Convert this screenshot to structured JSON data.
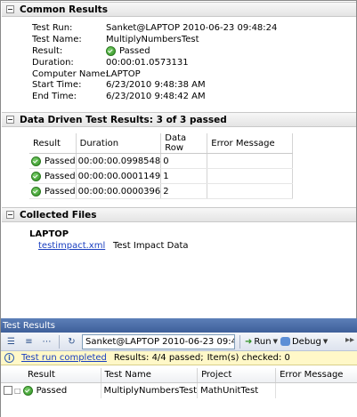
{
  "common_results": {
    "title": "Common Results",
    "fields": [
      {
        "label": "Test Run:",
        "value": "Sanket@LAPTOP 2010-06-23 09:48:24"
      },
      {
        "label": "Test Name:",
        "value": "MultiplyNumbersTest"
      },
      {
        "label": "Result:",
        "value": "Passed",
        "icon": "passed-icon"
      },
      {
        "label": "Duration:",
        "value": "00:00:01.0573131"
      },
      {
        "label": "Computer Name:",
        "value": "LAPTOP"
      },
      {
        "label": "Start Time:",
        "value": "6/23/2010 9:48:38 AM"
      },
      {
        "label": "End Time:",
        "value": "6/23/2010 9:48:42 AM"
      }
    ]
  },
  "data_driven": {
    "title": "Data Driven Test Results: 3 of 3 passed",
    "columns": [
      "Result",
      "Duration",
      "Data Row",
      "Error Message"
    ],
    "rows": [
      {
        "result": "Passed",
        "duration": "00:00:00.0998548",
        "data_row": "0",
        "error": ""
      },
      {
        "result": "Passed",
        "duration": "00:00:00.0001149",
        "data_row": "1",
        "error": ""
      },
      {
        "result": "Passed",
        "duration": "00:00:00.0000396",
        "data_row": "2",
        "error": ""
      }
    ]
  },
  "collected_files": {
    "title": "Collected Files",
    "machine": "LAPTOP",
    "files": [
      {
        "name": "testimpact.xml",
        "description": "Test Impact Data"
      }
    ]
  },
  "test_results_window": {
    "title": "Test Results",
    "toolbar": {
      "run_selector": "Sanket@LAPTOP 2010-06-23 09:4",
      "run_label": "Run",
      "debug_label": "Debug"
    },
    "status": {
      "link": "Test run completed",
      "summary": "Results: 4/4 passed;",
      "checked": "Item(s) checked: 0"
    },
    "columns": [
      "Result",
      "Test Name",
      "Project",
      "Error Message"
    ],
    "rows": [
      {
        "result": "Passed",
        "test_name": "MultiplyNumbersTest",
        "project": "MathUnitTest",
        "error": ""
      }
    ]
  },
  "colors": {
    "link": "#1a3fc0",
    "pass": "#2f8f22",
    "status_bar": "#fff8c8",
    "titlebar": "#4a6ca8"
  }
}
